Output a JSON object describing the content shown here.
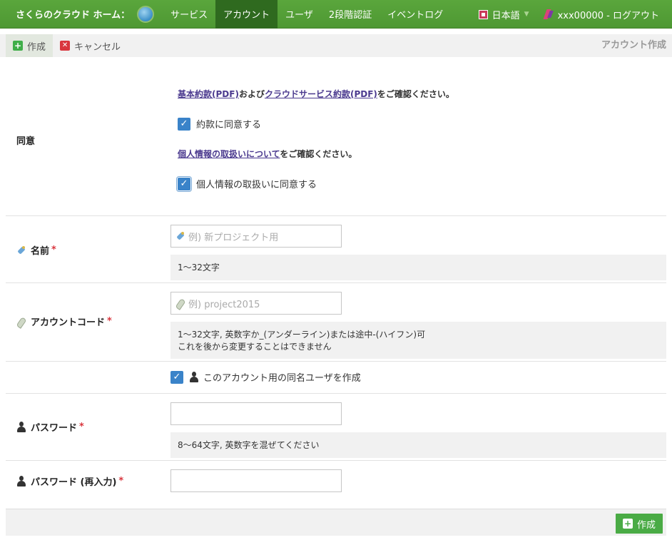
{
  "nav": {
    "brand": "さくらのクラウド ホーム：",
    "home_icon_glyph": "↻",
    "tabs": [
      {
        "label": "サービス",
        "active": false
      },
      {
        "label": "アカウント",
        "active": true
      },
      {
        "label": "ユーザ",
        "active": false
      },
      {
        "label": "2段階認証",
        "active": false
      },
      {
        "label": "イベントログ",
        "active": false
      }
    ],
    "language": "日本語",
    "logout": "xxx00000 - ログアウト"
  },
  "toolbar": {
    "create_label": "作成",
    "cancel_label": "キャンセル",
    "page_title": "アカウント作成"
  },
  "form": {
    "agreement": {
      "label": "同意",
      "terms_link_1": "基本約款(PDF)",
      "terms_and": "および",
      "terms_link_2": "クラウドサービス約款(PDF)",
      "terms_suffix": "をご確認ください。",
      "agree_terms": "約款に同意する",
      "privacy_link": "個人情報の取扱いについて",
      "privacy_suffix": "をご確認ください。",
      "agree_privacy": "個人情報の取扱いに同意する"
    },
    "name": {
      "label": "名前",
      "required": "*",
      "placeholder": "例) 新プロジェクト用",
      "hint": "1～32文字"
    },
    "account_code": {
      "label": "アカウントコード",
      "required": "*",
      "placeholder": "例) project2015",
      "hint_1": "1～32文字, 英数字か_(アンダーライン)または途中-(ハイフン)可",
      "hint_2": "これを後から変更することはできません"
    },
    "create_user": {
      "label": "このアカウント用の同名ユーザを作成"
    },
    "password": {
      "label": "パスワード",
      "required": "*",
      "value": "",
      "hint": "8～64文字, 英数字を混ぜてください"
    },
    "password_confirm": {
      "label": "パスワード (再入力)",
      "required": "*",
      "value": ""
    }
  },
  "footer": {
    "submit_label": "作成"
  },
  "check_glyph": "✓",
  "plus_glyph": "+",
  "x_glyph": "✕",
  "caret_glyph": "▼",
  "colors": {
    "nav_green": "#4e9833",
    "nav_active": "#2f6a1f",
    "checkbox_blue": "#3a83c9",
    "required_red": "#d9363e",
    "link_purple": "#4b3a8f",
    "submit_green": "#4aab45"
  }
}
